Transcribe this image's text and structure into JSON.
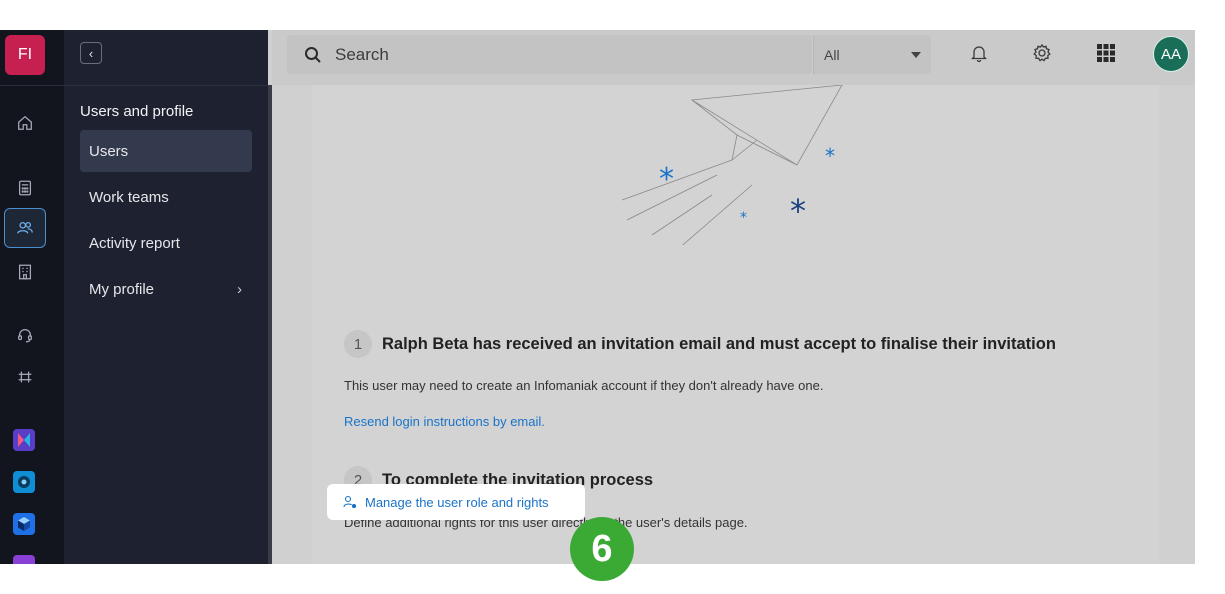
{
  "org": {
    "initials": "FI"
  },
  "rail": {
    "items": [
      {
        "icon": "home-icon"
      },
      {
        "icon": "calculator-icon"
      },
      {
        "icon": "users-icon",
        "active": true
      },
      {
        "icon": "building-icon"
      },
      {
        "icon": "headset-icon"
      },
      {
        "icon": "transfer-icon"
      }
    ],
    "apps": [
      {
        "icon": "kmail-app-icon",
        "color": "#5b3cc4"
      },
      {
        "icon": "kdrive-app-icon",
        "color": "#0f8ed6"
      },
      {
        "icon": "cube-app-icon",
        "color": "#1f6fe6"
      },
      {
        "icon": "chart-app-icon",
        "color": "#8a3fd6"
      }
    ]
  },
  "menu": {
    "heading": "Users and profile",
    "items": [
      {
        "label": "Users",
        "selected": true
      },
      {
        "label": "Work teams"
      },
      {
        "label": "Activity report"
      },
      {
        "label": "My profile",
        "has_chevron": true
      }
    ],
    "collapse_glyph": "‹"
  },
  "topbar": {
    "search_placeholder": "Search",
    "scope_value": "All",
    "avatar_initials": "AA",
    "icons": [
      "bell-icon",
      "gear-icon",
      "apps-grid-icon"
    ]
  },
  "panel": {
    "step1": {
      "number": "1",
      "title": "Ralph Beta has received an invitation email and must accept to finalise their invitation",
      "description": "This user may need to create an Infomaniak account if they don't already have one.",
      "link": "Resend login instructions by email."
    },
    "step2": {
      "number": "2",
      "title": "To complete the invitation process",
      "description": "Define additional rights for this user directly on the user's details page.",
      "button": "Manage the user role and rights"
    }
  },
  "annotation": {
    "number": "6"
  },
  "colors": {
    "accent": "#1a73c8",
    "org_badge": "#c5204f",
    "avatar": "#1a6e59",
    "annotation": "#3aaa35",
    "sidebar": "#1e2230",
    "rail": "#13151e"
  }
}
